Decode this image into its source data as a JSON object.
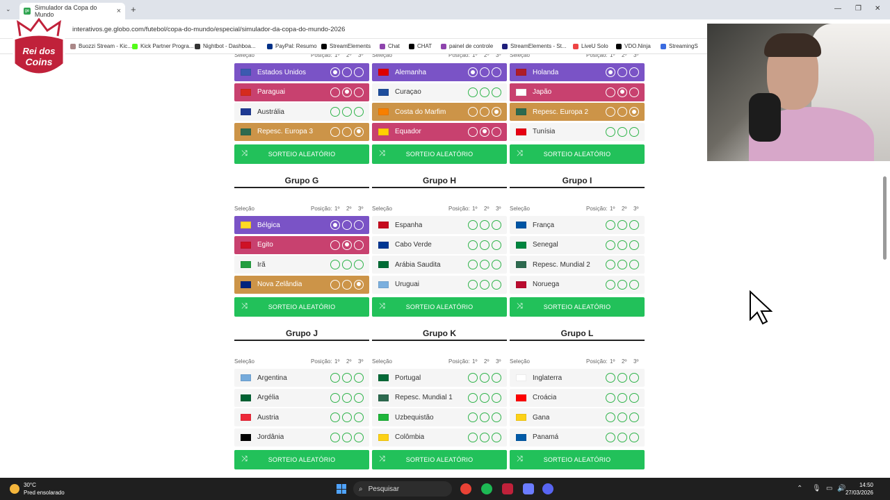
{
  "browser": {
    "tab_title": "Simulador da Copa do Mundo",
    "url": "interativos.ge.globo.com/futebol/copa-do-mundo/especial/simulador-da-copa-do-mundo-2026",
    "bookmarks": [
      "Buozzi Stream - Kic...",
      "Kick Partner Progra...",
      "Nightbot - Dashboa...",
      "PayPal: Resumo",
      "StreamElements",
      "Chat",
      "CHAT",
      "painel de controle",
      "StreamElements - St...",
      "LiveU Solo",
      "VDO.Ninja",
      "StreamingS"
    ]
  },
  "overlay": {
    "logo_text_1": "Rei dos",
    "logo_text_2": "Coins"
  },
  "labels": {
    "selecao": "Seleção",
    "posicao": "Posição:",
    "p1": "1º",
    "p2": "2º",
    "p3": "3º",
    "sorteio": "SORTEIO ALEATÓRIO"
  },
  "groups_top": [
    {
      "teams": [
        {
          "name": "Estados Unidos",
          "pos": 1,
          "flag": "#3c5ab0"
        },
        {
          "name": "Paraguai",
          "pos": 2,
          "flag": "#d52b1e"
        },
        {
          "name": "Austrália",
          "pos": 0,
          "flag": "#1f3a93"
        },
        {
          "name": "Repesc. Europa 3",
          "pos": 3,
          "flag": "#2d6a4f"
        }
      ]
    },
    {
      "teams": [
        {
          "name": "Alemanha",
          "pos": 1,
          "flag": "#d00"
        },
        {
          "name": "Curaçao",
          "pos": 0,
          "flag": "#1f4e9c"
        },
        {
          "name": "Costa do Marfim",
          "pos": 3,
          "flag": "#f77f00"
        },
        {
          "name": "Equador",
          "pos": 2,
          "flag": "#ffd100"
        }
      ]
    },
    {
      "teams": [
        {
          "name": "Holanda",
          "pos": 1,
          "flag": "#ae1c28"
        },
        {
          "name": "Japão",
          "pos": 2,
          "flag": "#ffffff"
        },
        {
          "name": "Repesc. Europa 2",
          "pos": 3,
          "flag": "#2d6a4f"
        },
        {
          "name": "Tunísia",
          "pos": 0,
          "flag": "#e70013"
        }
      ]
    }
  ],
  "groups_mid": [
    {
      "title": "Grupo G",
      "teams": [
        {
          "name": "Bélgica",
          "pos": 1,
          "flag": "#fdda24"
        },
        {
          "name": "Egito",
          "pos": 2,
          "flag": "#ce1126"
        },
        {
          "name": "Irã",
          "pos": 0,
          "flag": "#239f40"
        },
        {
          "name": "Nova Zelândia",
          "pos": 3,
          "flag": "#00247d"
        }
      ]
    },
    {
      "title": "Grupo H",
      "teams": [
        {
          "name": "Espanha",
          "pos": 0,
          "flag": "#c60b1e"
        },
        {
          "name": "Cabo Verde",
          "pos": 0,
          "flag": "#003893"
        },
        {
          "name": "Arábia Saudita",
          "pos": 0,
          "flag": "#006c35"
        },
        {
          "name": "Uruguai",
          "pos": 0,
          "flag": "#7bafde"
        }
      ]
    },
    {
      "title": "Grupo I",
      "teams": [
        {
          "name": "França",
          "pos": 0,
          "flag": "#0055a4"
        },
        {
          "name": "Senegal",
          "pos": 0,
          "flag": "#00853f"
        },
        {
          "name": "Repesc. Mundial 2",
          "pos": 0,
          "flag": "#2d6a4f"
        },
        {
          "name": "Noruega",
          "pos": 0,
          "flag": "#ba0c2f"
        }
      ]
    }
  ],
  "groups_bot": [
    {
      "title": "Grupo J",
      "teams": [
        {
          "name": "Argentina",
          "pos": 0,
          "flag": "#75aadb"
        },
        {
          "name": "Argélia",
          "pos": 0,
          "flag": "#006233"
        },
        {
          "name": "Áustria",
          "pos": 0,
          "flag": "#ed2939"
        },
        {
          "name": "Jordânia",
          "pos": 0,
          "flag": "#000000"
        }
      ]
    },
    {
      "title": "Grupo K",
      "teams": [
        {
          "name": "Portugal",
          "pos": 0,
          "flag": "#046a38"
        },
        {
          "name": "Repesc. Mundial 1",
          "pos": 0,
          "flag": "#2d6a4f"
        },
        {
          "name": "Uzbequistão",
          "pos": 0,
          "flag": "#1eb53a"
        },
        {
          "name": "Colômbia",
          "pos": 0,
          "flag": "#fcd116"
        }
      ]
    },
    {
      "title": "Grupo L",
      "teams": [
        {
          "name": "Inglaterra",
          "pos": 0,
          "flag": "#ffffff"
        },
        {
          "name": "Croácia",
          "pos": 0,
          "flag": "#ff0000"
        },
        {
          "name": "Gana",
          "pos": 0,
          "flag": "#fcd116"
        },
        {
          "name": "Panamá",
          "pos": 0,
          "flag": "#005aa7"
        }
      ]
    }
  ],
  "taskbar": {
    "temp": "30°C",
    "weather": "Pred ensolarado",
    "search": "Pesquisar",
    "time": "14:50",
    "date": "27/03/2026"
  }
}
